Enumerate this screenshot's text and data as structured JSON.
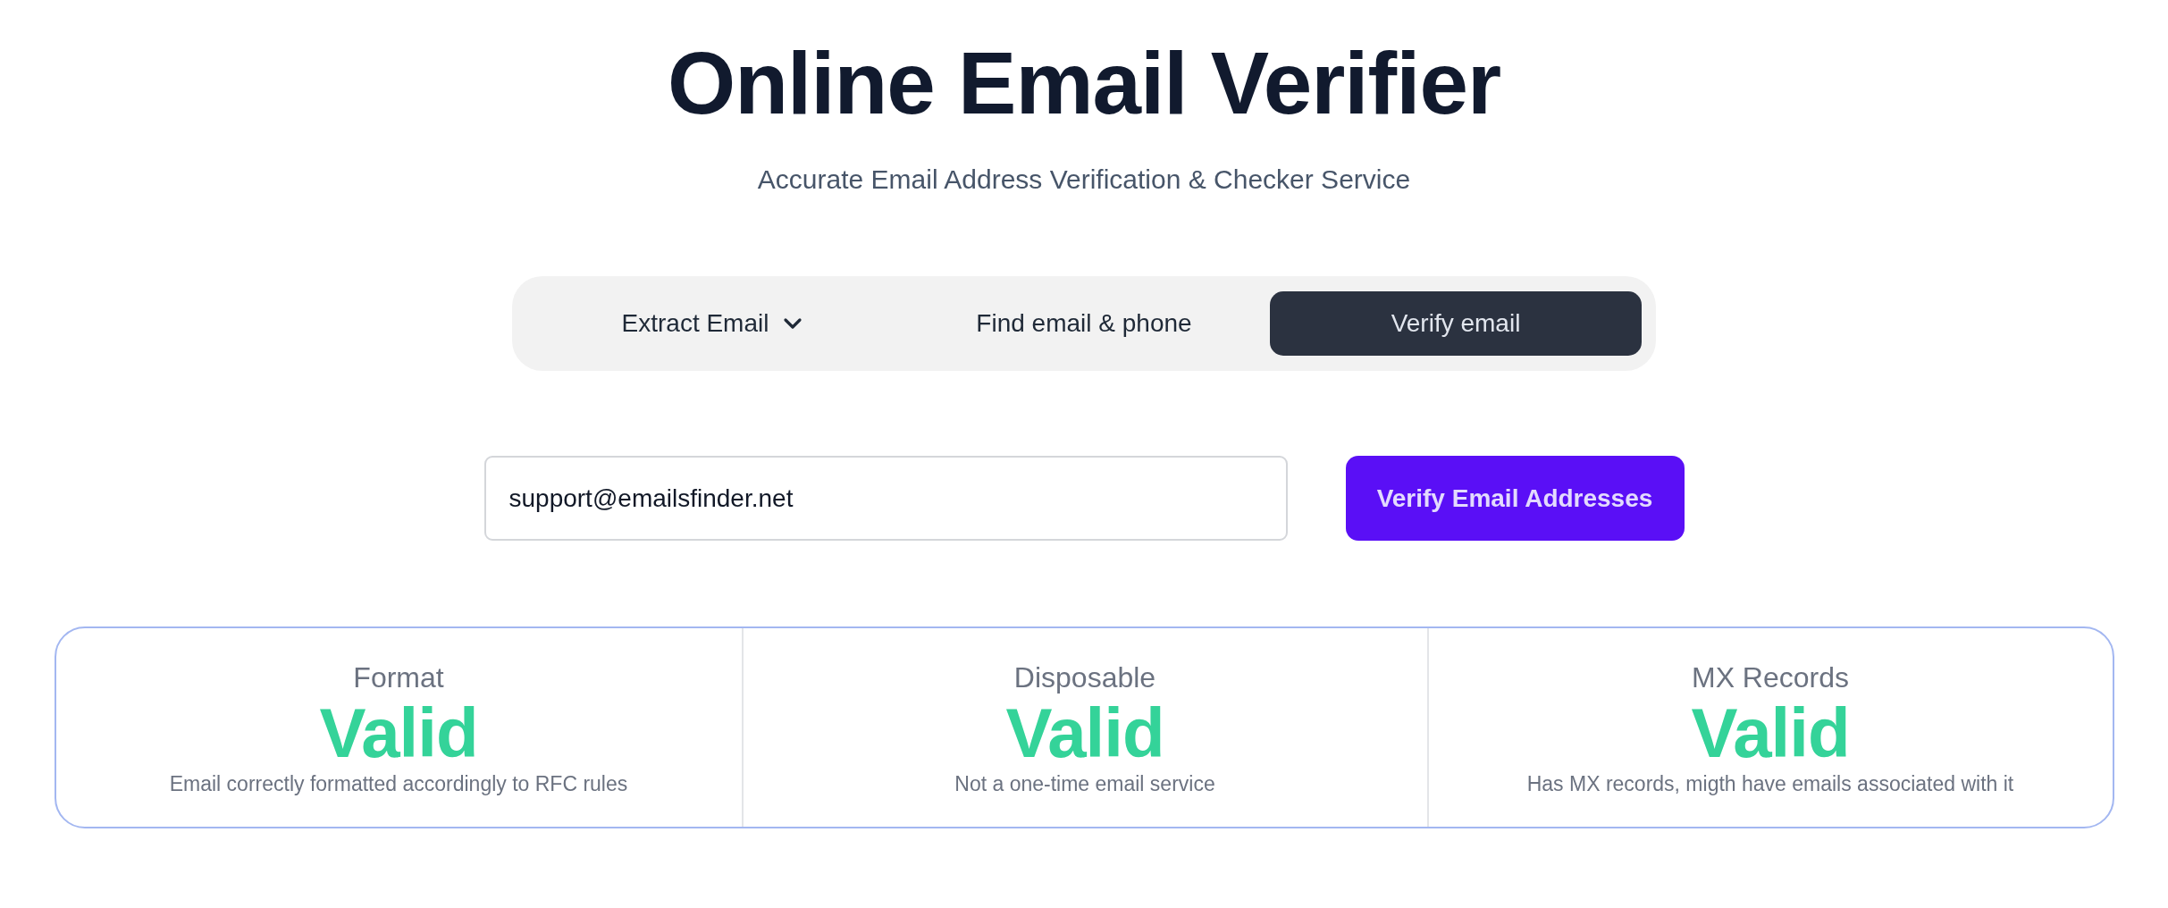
{
  "header": {
    "title": "Online Email Verifier",
    "subtitle": "Accurate Email Address Verification & Checker Service"
  },
  "tabs": [
    {
      "label": "Extract Email",
      "kind": "menu",
      "selected": false
    },
    {
      "label": "Find email & phone",
      "kind": "link",
      "selected": false
    },
    {
      "label": "Verify email",
      "kind": "link",
      "selected": true
    }
  ],
  "form": {
    "email": {
      "value": "support@emailsfinder.net"
    },
    "submit": "Verify Email Addresses"
  },
  "results": [
    {
      "label": "Format",
      "status": "Valid",
      "description": "Email correctly formatted accordingly to RFC rules"
    },
    {
      "label": "Disposable",
      "status": "Valid",
      "description": "Not a one-time email service"
    },
    {
      "label": "MX Records",
      "status": "Valid",
      "description": "Has MX records, migth have emails associated with it"
    }
  ]
}
